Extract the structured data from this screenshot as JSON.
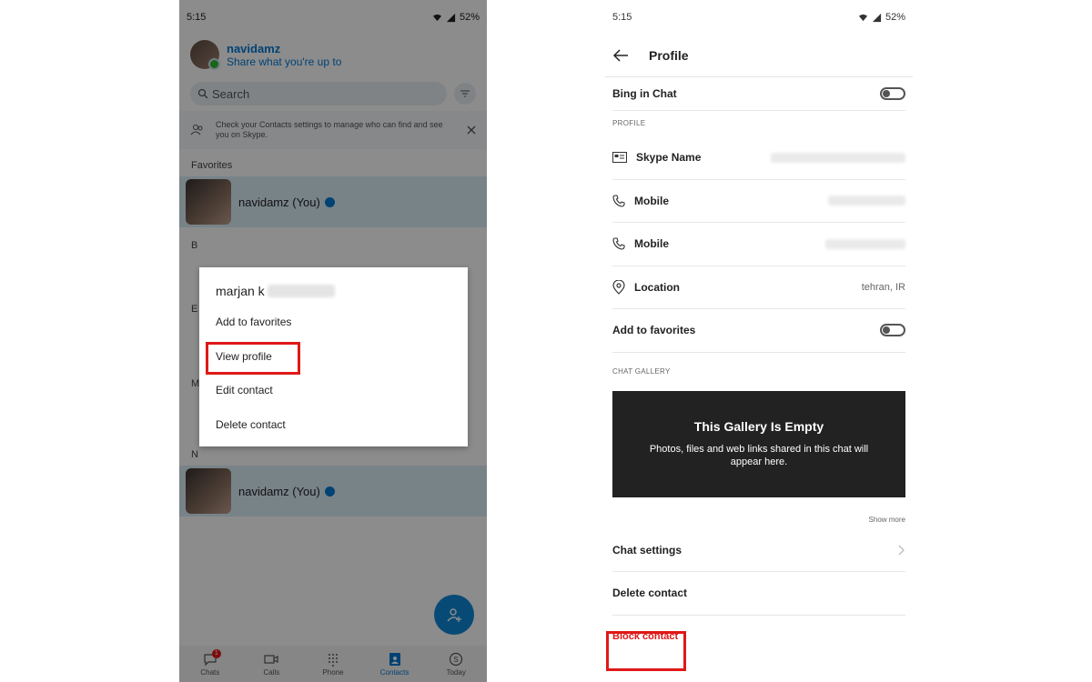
{
  "left": {
    "status": {
      "time": "5:15",
      "battery": "52%"
    },
    "profile": {
      "name": "navidamz",
      "subtitle": "Share what you're up to"
    },
    "search": {
      "placeholder": "Search"
    },
    "notice": {
      "text": "Check your Contacts settings to manage who can find and see you on Skype."
    },
    "favorites_label": "Favorites",
    "favorite_contact": {
      "name": "navidamz (You)"
    },
    "letters": [
      "B",
      "E",
      "M",
      "N"
    ],
    "n_contact": {
      "name": "navidamz (You)"
    },
    "context_menu": {
      "title": "marjan k",
      "items": [
        "Add to favorites",
        "View profile",
        "Edit contact",
        "Delete contact"
      ]
    },
    "nav": [
      {
        "label": "Chats",
        "icon": "chat-icon",
        "badge": "1"
      },
      {
        "label": "Calls",
        "icon": "video-icon"
      },
      {
        "label": "Phone",
        "icon": "dialpad-icon"
      },
      {
        "label": "Contacts",
        "icon": "contacts-icon"
      },
      {
        "label": "Today",
        "icon": "skype-icon"
      }
    ]
  },
  "right": {
    "status": {
      "time": "5:15",
      "battery": "52%"
    },
    "header": {
      "title": "Profile"
    },
    "bing_label": "Bing in Chat",
    "profile_section": "PROFILE",
    "rows": [
      {
        "label": "Skype Name",
        "icon": "id-card-icon"
      },
      {
        "label": "Mobile",
        "icon": "phone-icon"
      },
      {
        "label": "Mobile",
        "icon": "phone-icon"
      },
      {
        "label": "Location",
        "icon": "location-icon",
        "value": "tehran, IR"
      }
    ],
    "favorites_label": "Add to favorites",
    "gallery_section": "CHAT GALLERY",
    "gallery": {
      "title": "This Gallery Is Empty",
      "text": "Photos, files and web links shared in this chat will appear here."
    },
    "show_more": "Show more",
    "chat_settings": "Chat settings",
    "delete_contact": "Delete contact",
    "block_contact": "Block contact"
  },
  "colors": {
    "accent": "#0078d4",
    "highlight_box": "#e01818",
    "gallery_bg": "#222222"
  }
}
